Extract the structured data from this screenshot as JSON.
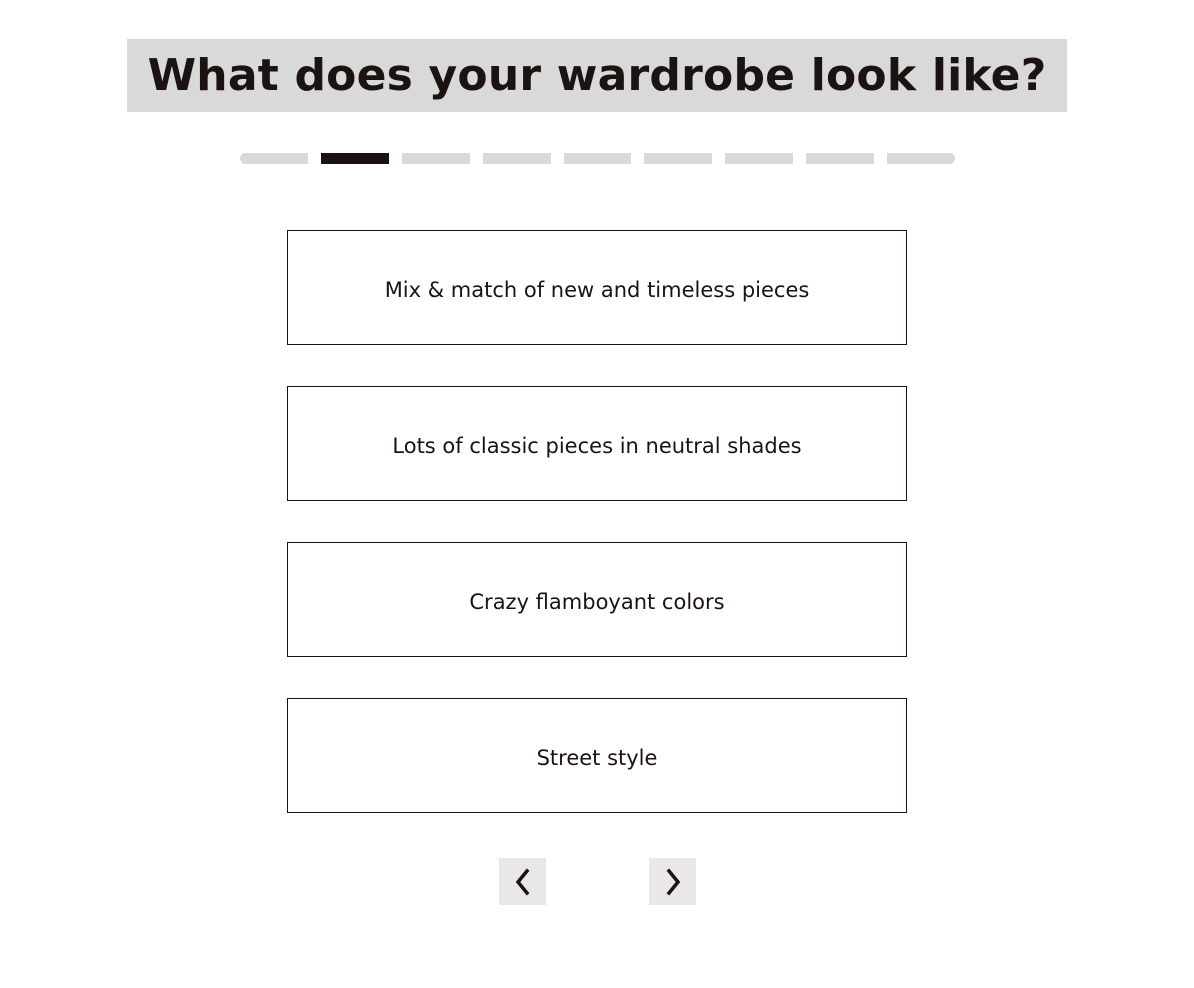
{
  "quiz": {
    "title": "What does your wardrobe look like?",
    "progress": {
      "total_steps": 9,
      "current_step": 2
    },
    "options": [
      {
        "label": "Mix & match of new and timeless pieces"
      },
      {
        "label": "Lots of classic pieces in neutral shades"
      },
      {
        "label": "Crazy flamboyant colors"
      },
      {
        "label": "Street style"
      }
    ],
    "nav": {
      "prev_icon": "chevron-left-icon",
      "next_icon": "chevron-right-icon"
    }
  },
  "colors": {
    "text": "#1a1311",
    "title_background": "#d9d9d9",
    "progress_inactive": "#d9d9d9",
    "progress_active": "#1a1311",
    "nav_background": "#e9e8e6"
  }
}
